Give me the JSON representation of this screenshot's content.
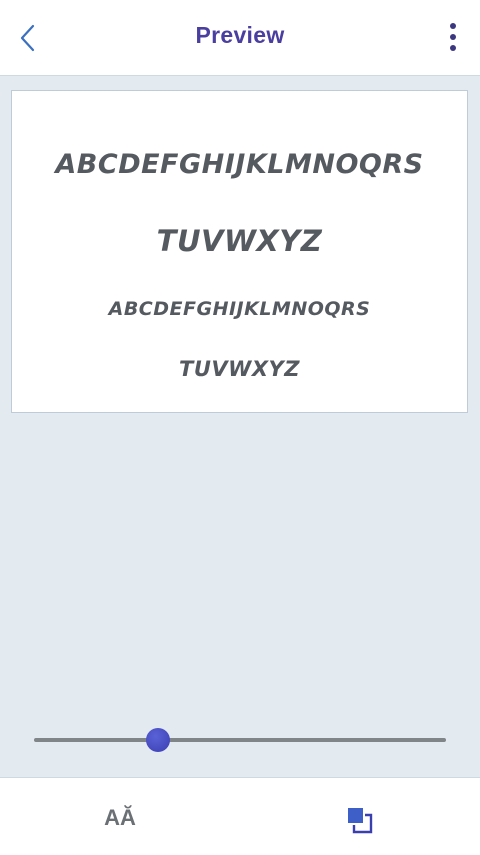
{
  "header": {
    "title": "Preview",
    "back_icon": "chevron-left-icon",
    "more_icon": "more-vertical-icon"
  },
  "preview": {
    "lines": [
      "ABCDEFGHIJKLMNOQRS",
      "TUVWXYZ",
      "ABCDEFGHIJKLMNOQRS",
      "TUVWXYZ"
    ]
  },
  "size_slider": {
    "value_fraction": 0.3
  },
  "bottom_bar": {
    "font_button_label": "AĂ",
    "color_icon": "layers-color-icon"
  },
  "colors": {
    "accent": "#4a3fa0",
    "thumb": "#3f45b8",
    "text": "#555a60",
    "background": "#e4ebf0"
  }
}
